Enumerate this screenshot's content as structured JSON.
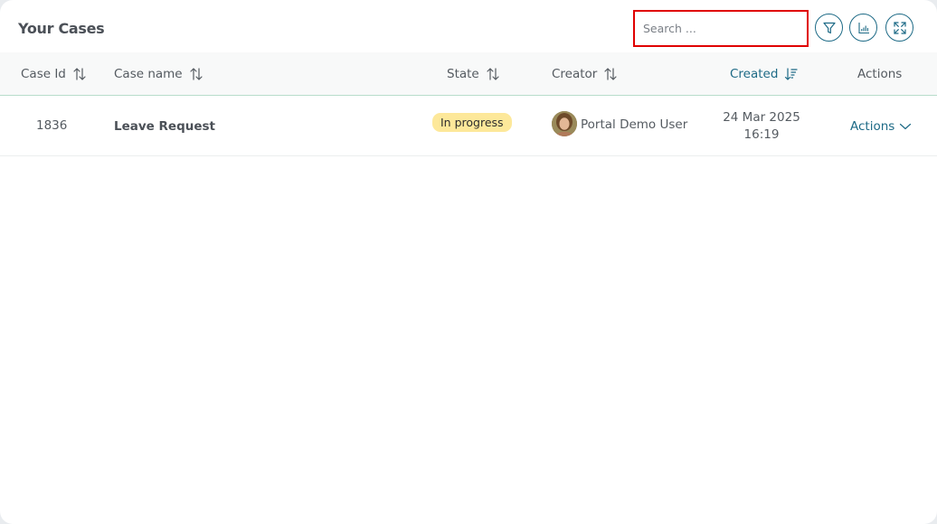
{
  "panel": {
    "title": "Your Cases",
    "search_placeholder": "Search ...",
    "search_value": ""
  },
  "toolbar": {
    "buttons": [
      {
        "icon": "filter-icon"
      },
      {
        "icon": "chart-icon"
      },
      {
        "icon": "expand-icon"
      }
    ]
  },
  "table": {
    "columns": [
      {
        "label": "Case Id",
        "sort": "none"
      },
      {
        "label": "Case name",
        "sort": "none"
      },
      {
        "label": "State",
        "sort": "none"
      },
      {
        "label": "Creator",
        "sort": "none"
      },
      {
        "label": "Created",
        "sort": "descending"
      },
      {
        "label": "Actions",
        "sort": null
      }
    ],
    "rows": [
      {
        "case_id": "1836",
        "case_name": "Leave Request",
        "state": "In progress",
        "creator": "Portal Demo User",
        "created_date": "24 Mar 2025",
        "created_time": "16:19",
        "actions_label": "Actions"
      }
    ]
  },
  "colors": {
    "accent": "#1d6a86",
    "badge_in_progress": "#fde89a",
    "search_highlight": "#e00000"
  }
}
